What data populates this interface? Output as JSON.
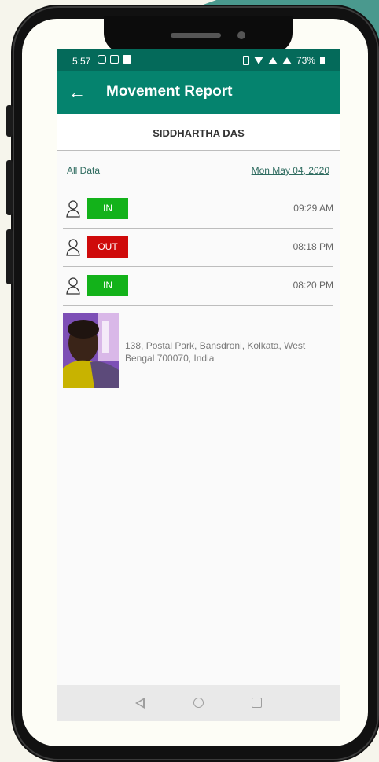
{
  "status_bar": {
    "time": "5:57",
    "battery": "73%",
    "icons": [
      "instagram-icon",
      "app-icon",
      "notification-icon",
      "phone-icon",
      "wifi-icon",
      "signal-icon",
      "signal-empty-icon",
      "battery-icon"
    ]
  },
  "app_bar": {
    "title": "Movement Report",
    "back_icon": "arrow-left-icon"
  },
  "employee": {
    "name": "SIDDHARTHA  DAS"
  },
  "filter": {
    "all_data_label": "All Data",
    "date": "Mon May 04, 2020"
  },
  "entries": [
    {
      "type": "IN",
      "time": "09:29 AM",
      "color": "#13b21a"
    },
    {
      "type": "OUT",
      "time": "08:18 PM",
      "color": "#cf0a0a"
    },
    {
      "type": "IN",
      "time": "08:20 PM",
      "color": "#13b21a"
    }
  ],
  "location": {
    "address": "138, Postal Park, Bansdroni, Kolkata, West Bengal 700070, India"
  },
  "colors": {
    "app_bar": "#05836e",
    "status_bar": "#046a5a",
    "in": "#13b21a",
    "out": "#cf0a0a",
    "accent_text": "#2e6b5f"
  }
}
